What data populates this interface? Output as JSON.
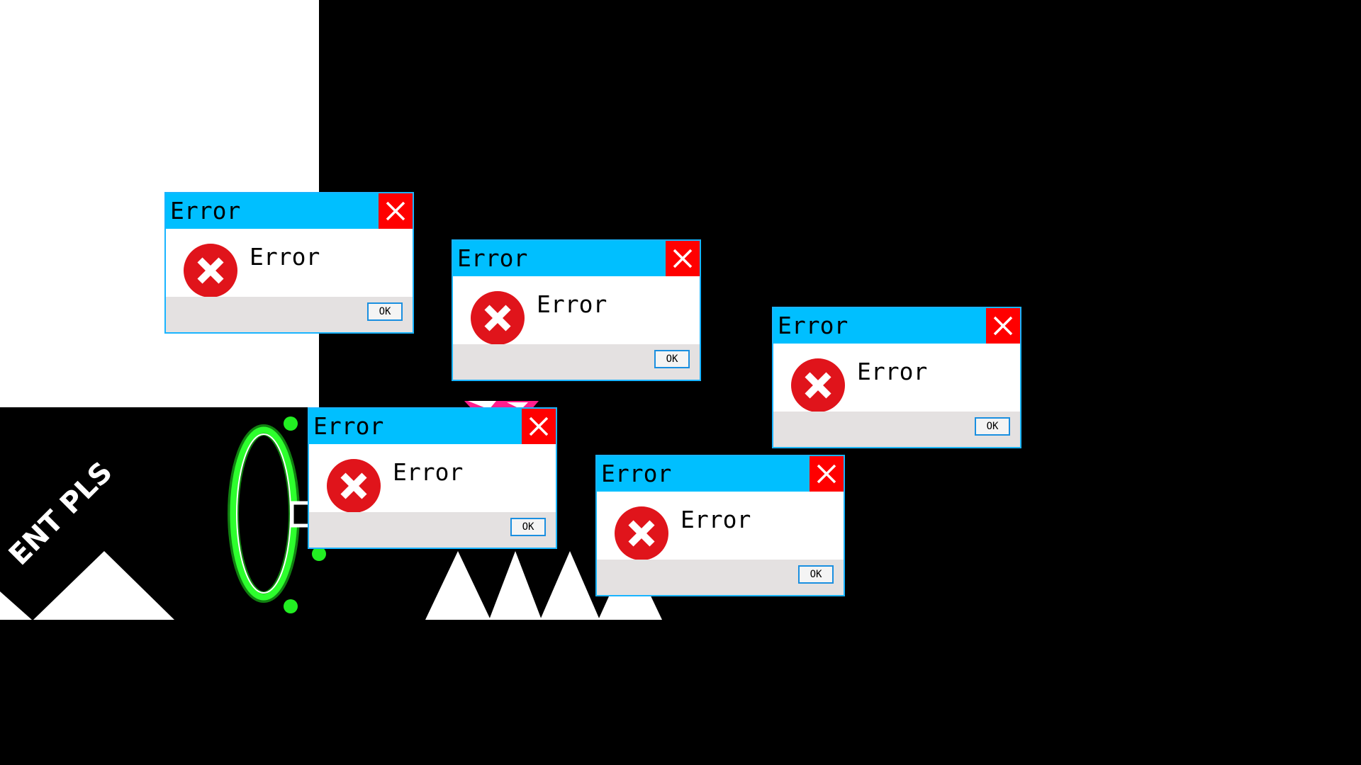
{
  "game": {
    "sign_text": "ENT PLS",
    "colors": {
      "background": "#000000",
      "wall": "#ffffff",
      "portal": "#22ff22",
      "accent_pink": "#ff1e8c"
    }
  },
  "dialogs": [
    {
      "title": "Error",
      "message": "Error",
      "ok_label": "OK",
      "icon": "error-x-icon"
    },
    {
      "title": "Error",
      "message": "Error",
      "ok_label": "OK",
      "icon": "error-x-icon"
    },
    {
      "title": "Error",
      "message": "Error",
      "ok_label": "OK",
      "icon": "error-x-icon"
    },
    {
      "title": "Error",
      "message": "Error",
      "ok_label": "OK",
      "icon": "error-x-icon"
    },
    {
      "title": "Error",
      "message": "Error",
      "ok_label": "OK",
      "icon": "error-x-icon"
    }
  ],
  "dialog_style": {
    "titlebar_color": "#00bfff",
    "close_color": "#ff0000",
    "footer_color": "#e4e1e1",
    "icon_color": "#e0141b"
  }
}
